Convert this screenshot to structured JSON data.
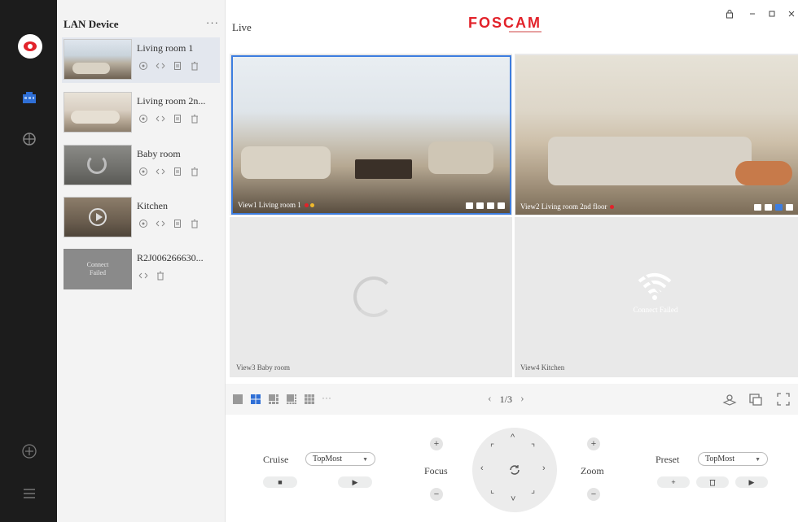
{
  "sidebar": {
    "header": "LAN Device",
    "more": "···",
    "devices": [
      {
        "name": "Living room 1",
        "thumb": "living-room-1"
      },
      {
        "name": "Living room 2n...",
        "thumb": "living-room-2"
      },
      {
        "name": "Baby room",
        "thumb": "baby-room"
      },
      {
        "name": "Kitchen",
        "thumb": "kitchen"
      },
      {
        "name": "R2J006266630...",
        "thumb": "failed",
        "thumb_text_1": "Connect",
        "thumb_text_2": "Failed"
      }
    ]
  },
  "titlebar": {
    "section": "Live",
    "brand": "FOSCAM"
  },
  "views": [
    {
      "label": "View1 Living room 1"
    },
    {
      "label": "View2 Living room 2nd floor"
    },
    {
      "label": "View3 Baby room"
    },
    {
      "label": "View4 Kitchen",
      "overlay_text": "Connect Failed"
    }
  ],
  "layoutbar": {
    "page": "1/3",
    "prev": "‹",
    "next": "›",
    "more": "···"
  },
  "ptz": {
    "cruise_label": "Cruise",
    "cruise_value": "TopMost",
    "focus_label": "Focus",
    "zoom_label": "Zoom",
    "preset_label": "Preset",
    "preset_value": "TopMost"
  },
  "colors": {
    "brand_red": "#e2222a",
    "selected_blue": "#3d7ddf",
    "rail_bg": "#1c1c1c"
  }
}
